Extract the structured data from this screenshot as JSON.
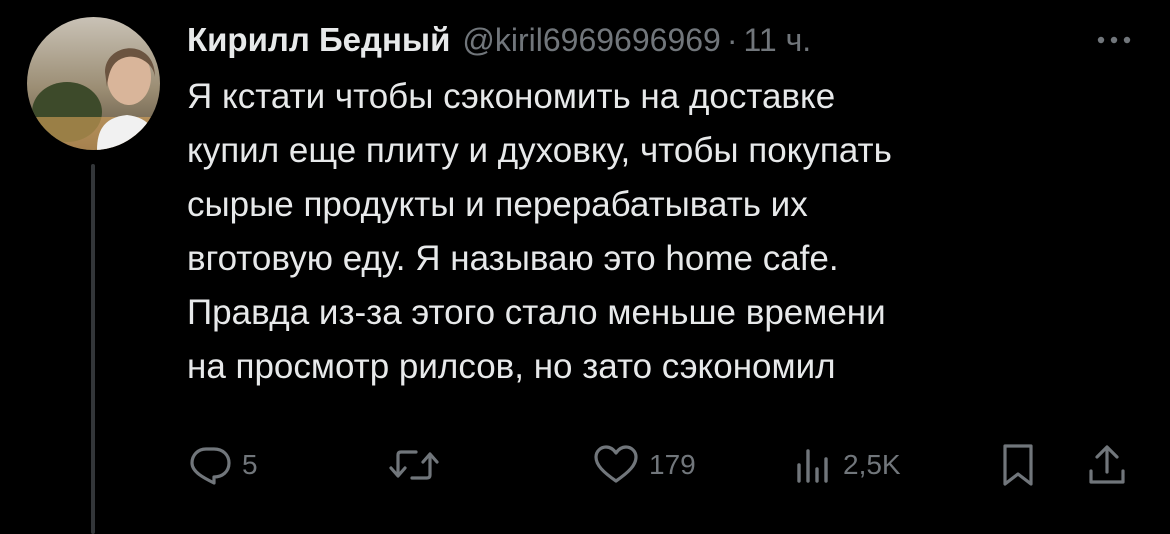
{
  "tweet": {
    "author_name": "Кирилл Бедный",
    "handle": "@kiril6969696969",
    "separator": "·",
    "time": "11 ч.",
    "text_lines": [
      "Я кстати чтобы сэкономить на доставке",
      "купил еще плиту и духовку, чтобы покупать",
      "сырые продукты и перерабатывать их",
      "вготовую еду. Я называю это home cafe.",
      "Правда из-за этого стало меньше времени",
      "на просмотр рилсов, но зато сэкономил"
    ]
  },
  "actions": {
    "replies": "5",
    "retweets": "",
    "likes": "179",
    "views": "2,5K"
  },
  "colors": {
    "background": "#000000",
    "text": "#e7e9ea",
    "muted": "#71767b",
    "thread_line": "#333639"
  },
  "icons": [
    "more-icon",
    "reply-icon",
    "retweet-icon",
    "like-icon",
    "views-icon",
    "bookmark-icon",
    "share-icon"
  ]
}
